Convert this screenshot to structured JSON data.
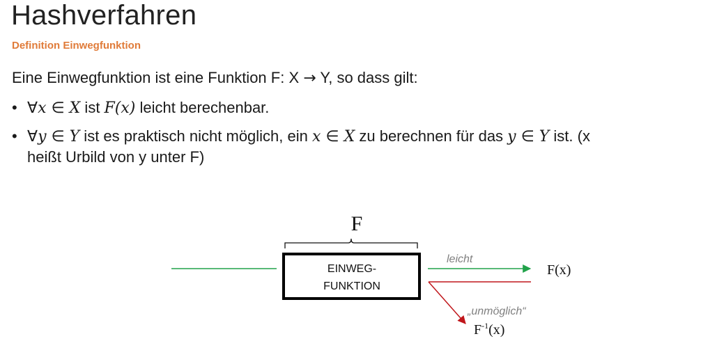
{
  "title": "Hashverfahren",
  "subtitle": "Definition Einwegfunktion",
  "intro": {
    "lead": "Eine Einwegfunktion ist eine Funktion F: X ",
    "arrow": "→",
    "tail": " Y, so dass gilt:"
  },
  "bullets": [
    {
      "symbol": "•",
      "forall": "∀",
      "var": "x",
      "in": " ∈ ",
      "set": "X",
      "mid": " ist ",
      "fx": "F(x)",
      "rest": " leicht berechenbar."
    },
    {
      "symbol": "•",
      "forall": "∀",
      "var": "y",
      "in": " ∈ ",
      "set": "Y",
      "mid": " ist es praktisch nicht möglich, ein ",
      "var2": "x",
      "in2": " ∈ ",
      "set2": "X",
      "mid2": " zu berechnen für das ",
      "var3": "y",
      "in3": " ∈ ",
      "set3": "Y",
      "rest": " ist. (x",
      "continuation": "heißt Urbild von y unter F)"
    }
  ],
  "diagram": {
    "brace_label": "F",
    "box_line1": "EINWEG-",
    "box_line2": "FUNKTION",
    "easy_label": "leicht",
    "output_label": "F(x)",
    "hard_label": "„unmöglich“",
    "inverse_base": "F",
    "inverse_sup": "-1",
    "inverse_arg": "(x)",
    "colors": {
      "green": "#21a24a",
      "red": "#c0161b",
      "box": "#000000",
      "label_gray": "#808080"
    }
  }
}
